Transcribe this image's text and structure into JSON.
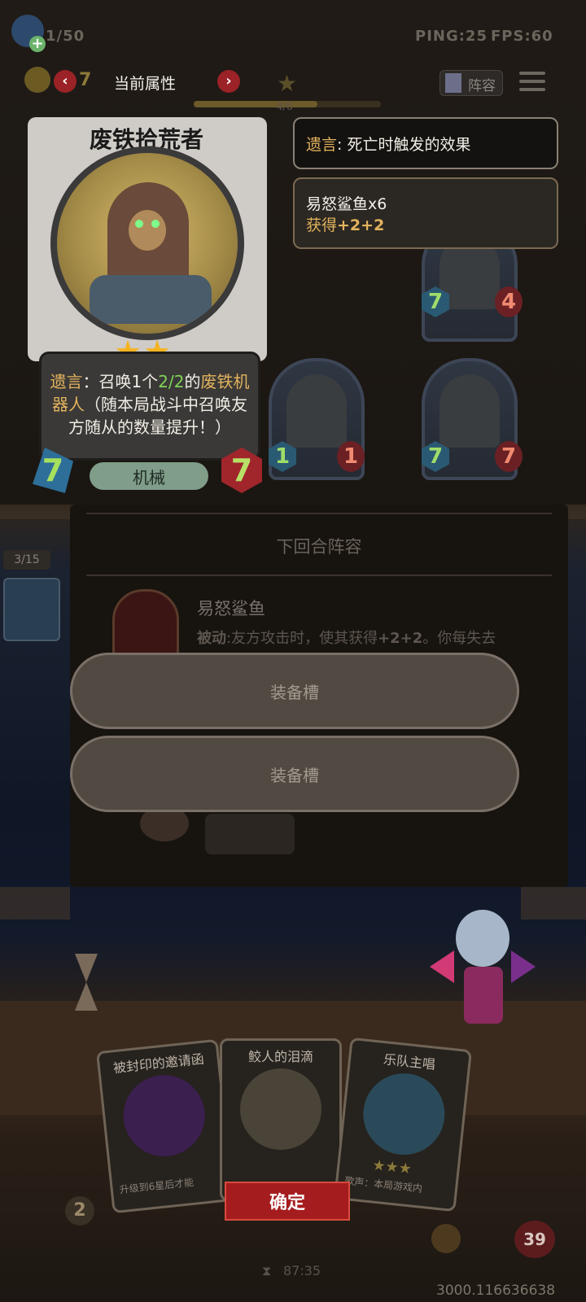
{
  "hud": {
    "population": "1/50",
    "ping": "PING:25",
    "fps": "FPS:60",
    "gold": "7",
    "attribute_label": "当前属性",
    "star_progress": "4/6",
    "lineup_button": "阵容"
  },
  "card": {
    "name": "废铁拾荒者",
    "stars": 2,
    "desc_keyword": "遗言",
    "desc_part1": "：召唤1个",
    "desc_stats": "2/2",
    "desc_part2": "的",
    "desc_target": "废铁机器人",
    "desc_part3": "（随本局战斗中召唤友方随从的数量提升！）",
    "attack": "7",
    "health": "7",
    "tribe": "机械"
  },
  "info": {
    "keyword": "遗言",
    "keyword_desc": ": 死亡时触发的效果",
    "buff_title": "易怒鲨鱼x6",
    "buff_prefix": "获得",
    "buff_value": "+2+2"
  },
  "board": {
    "minions": [
      {
        "attack": "7",
        "health": "4"
      },
      {
        "attack": "1",
        "health": "1"
      },
      {
        "attack": "7",
        "health": "7"
      }
    ]
  },
  "lineup": {
    "header": "下回合阵容",
    "hero_name": "易怒鲨鱼",
    "passive_label": "被动",
    "passive_text": ":友方攻击时，使其获得",
    "passive_value": "+2+2",
    "passive_tail": "。你每失去",
    "slot1": "装备槽",
    "slot2": "装备槽"
  },
  "side": {
    "queue": "3/15"
  },
  "hand": {
    "cards": [
      {
        "title": "被封印的邀请函",
        "note": "升级到6星后才能"
      },
      {
        "title": "鲛人的泪滴"
      },
      {
        "title": "乐队主唱",
        "note": "歌声：本局游戏内"
      }
    ],
    "confirm": "确定",
    "timer": "87:35",
    "left_gem": "2",
    "health": "39"
  },
  "footer": {
    "coords": "3000.116636638"
  },
  "colors": {
    "confirm_bg": "#a51c1f",
    "keyword": "#e2b35d",
    "stat_green": "#7ed357"
  }
}
